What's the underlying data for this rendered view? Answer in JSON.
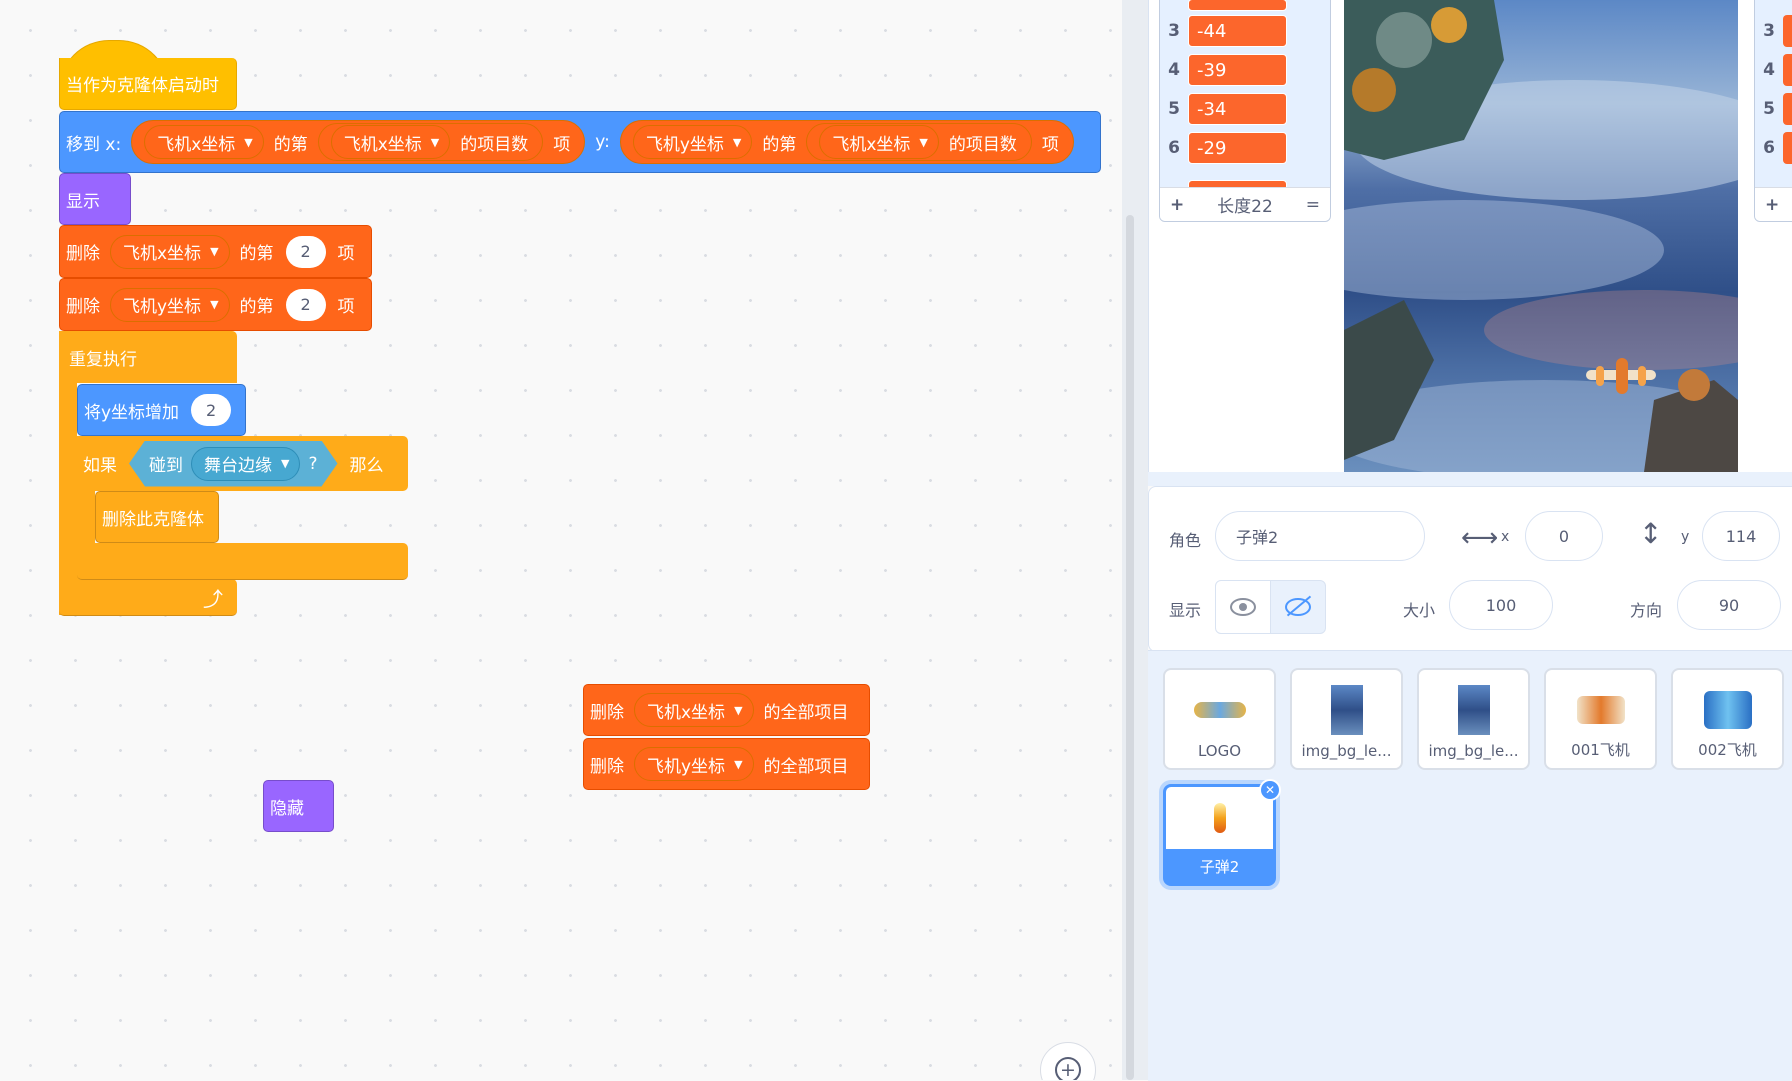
{
  "code": {
    "hat": "当作为克隆体启动时",
    "goto": {
      "label": "移到 x:",
      "y_label": "y:",
      "of_nth": "的第",
      "item_count": "的项目数",
      "item": "项",
      "list_x": "飞机x坐标",
      "list_y": "飞机y坐标"
    },
    "show": "显示",
    "delete1": {
      "label": "删除",
      "list": "飞机x坐标",
      "of_nth": "的第",
      "value": "2",
      "item": "项"
    },
    "delete2": {
      "label": "删除",
      "list": "飞机y坐标",
      "of_nth": "的第",
      "value": "2",
      "item": "项"
    },
    "forever": "重复执行",
    "change_y": {
      "label": "将y坐标增加",
      "value": "2"
    },
    "if": {
      "label": "如果",
      "touching": "碰到",
      "target": "舞台边缘",
      "q": "?",
      "then": "那么"
    },
    "delete_clone": "删除此克隆体",
    "delete_all_x": {
      "label": "删除",
      "list": "飞机x坐标",
      "suffix": "的全部项目"
    },
    "delete_all_y": {
      "label": "删除",
      "list": "飞机y坐标",
      "suffix": "的全部项目"
    },
    "hide": "隐藏",
    "loop_arrow": "⤴",
    "zoom_in": "+"
  },
  "list_monitor": {
    "rows": [
      {
        "index": "3",
        "value": "-44"
      },
      {
        "index": "4",
        "value": "-39"
      },
      {
        "index": "5",
        "value": "-34"
      },
      {
        "index": "6",
        "value": "-29"
      }
    ],
    "add": "+",
    "length": "长度22",
    "resize": "="
  },
  "list_monitor2": {
    "rows": [
      "3",
      "4",
      "5",
      "6"
    ],
    "add": "+"
  },
  "sprite_info": {
    "sprite_label": "角色",
    "sprite_name": "子弹2",
    "x_label": "x",
    "x_value": "0",
    "y_label": "y",
    "y_value": "114",
    "show_label": "显示",
    "size_label": "大小",
    "size_value": "100",
    "direction_label": "方向",
    "direction_value": "90"
  },
  "sprites": [
    {
      "name": "LOGO"
    },
    {
      "name": "img_bg_le..."
    },
    {
      "name": "img_bg_le..."
    },
    {
      "name": "001飞机"
    },
    {
      "name": "002飞机"
    },
    {
      "name": "子弹2",
      "selected": true
    }
  ],
  "colors": {
    "events": "#ffbf00",
    "motion": "#4c97ff",
    "looks": "#9966ff",
    "data": "#ff661a",
    "control": "#ffab19",
    "sensing": "#5cb1d6",
    "selected": "#4c97ff"
  }
}
